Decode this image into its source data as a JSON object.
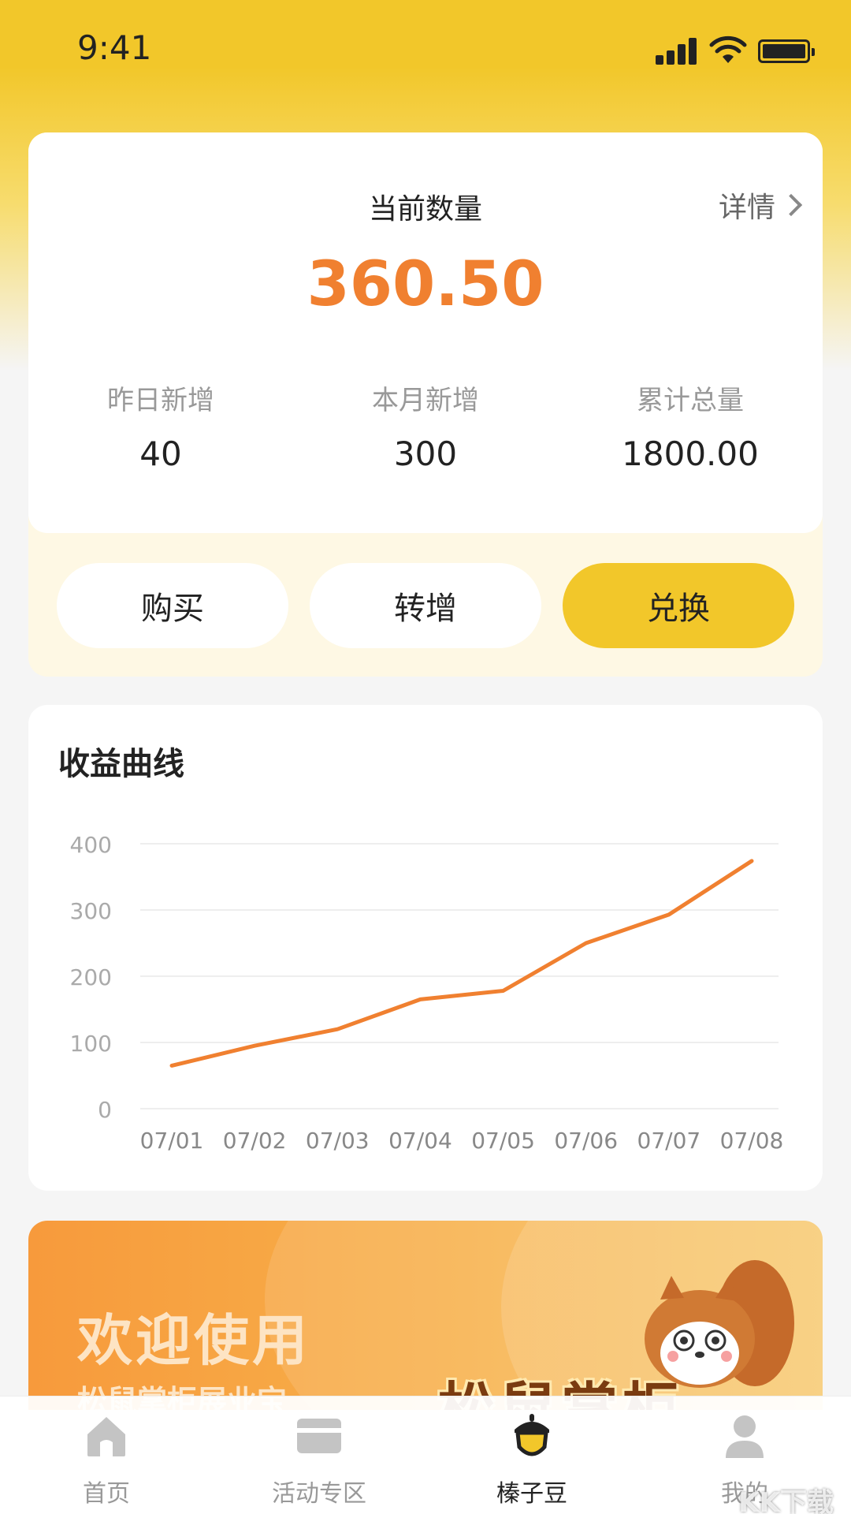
{
  "status_bar": {
    "time": "9:41"
  },
  "balance_card": {
    "title": "当前数量",
    "detail_label": "详情",
    "amount": "360.50",
    "stats": [
      {
        "label": "昨日新增",
        "value": "40"
      },
      {
        "label": "本月新增",
        "value": "300"
      },
      {
        "label": "累计总量",
        "value": "1800.00"
      }
    ]
  },
  "actions": {
    "buy": "购买",
    "transfer": "转增",
    "exchange": "兑换"
  },
  "chart_section": {
    "title": "收益曲线"
  },
  "chart_data": {
    "type": "line",
    "title": "收益曲线",
    "x": [
      "07/01",
      "07/02",
      "07/03",
      "07/04",
      "07/05",
      "07/06",
      "07/07",
      "07/08"
    ],
    "series": [
      {
        "values": [
          65,
          95,
          120,
          165,
          178,
          250,
          293,
          374
        ]
      }
    ],
    "yticks": [
      "0",
      "100",
      "200",
      "300",
      "400"
    ],
    "ylim": [
      0,
      400
    ],
    "grid": true,
    "line_color": "#f08030"
  },
  "banner": {
    "title": "欢迎使用",
    "subtitle": "松鼠掌柜展业宝",
    "logo_text": "松鼠掌柜"
  },
  "tab_bar": {
    "tabs": [
      {
        "label": "首页",
        "icon": "home-icon"
      },
      {
        "label": "活动专区",
        "icon": "card-icon"
      },
      {
        "label": "榛子豆",
        "icon": "acorn-icon"
      },
      {
        "label": "我的",
        "icon": "user-icon"
      }
    ],
    "active_index": 2
  },
  "watermark": "KK下载"
}
